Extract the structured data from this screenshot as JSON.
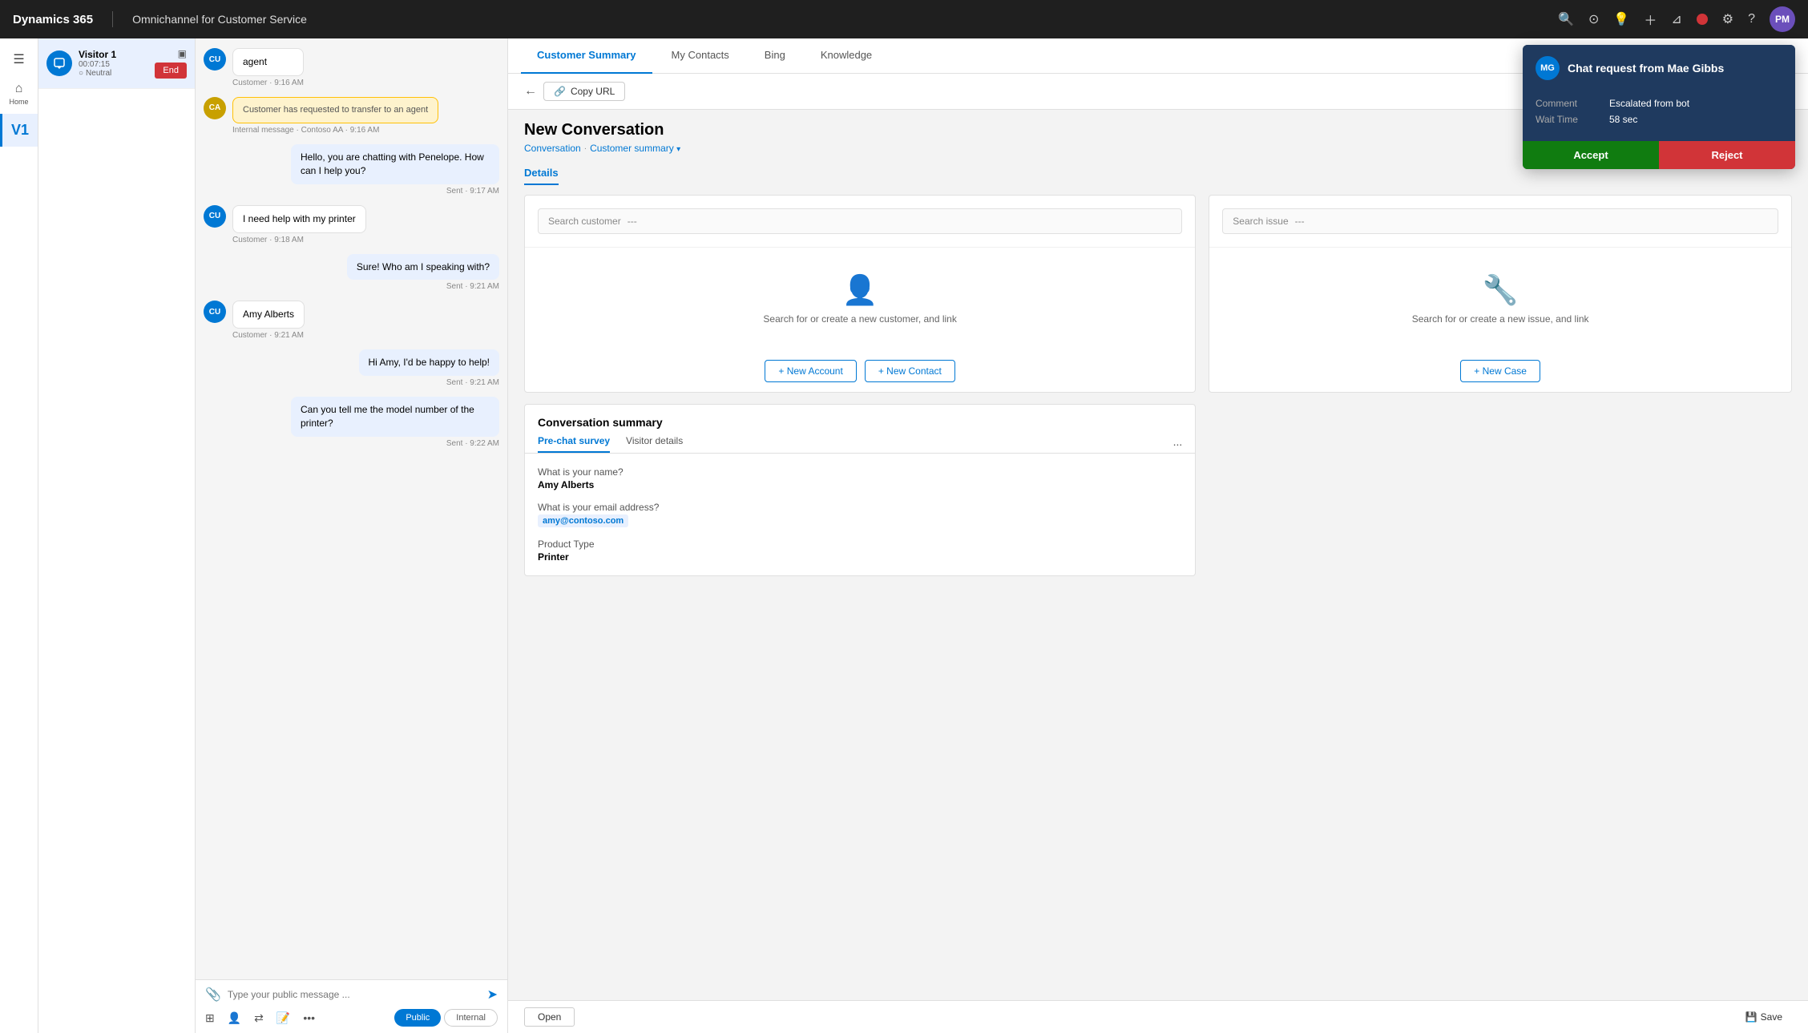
{
  "brand": {
    "name": "Dynamics 365",
    "app": "Omnichannel for Customer Service"
  },
  "topnav": {
    "icons": [
      "search",
      "dashboard",
      "idea",
      "add",
      "filter",
      "settings",
      "help"
    ],
    "avatar_label": "PM"
  },
  "sidebar": {
    "home_label": "Home",
    "visitor_label": "Visitor 1"
  },
  "conversation_panel": {
    "visitor_name": "Visitor 1",
    "timer": "00:07:15",
    "sentiment": "Neutral",
    "end_button": "End"
  },
  "messages": [
    {
      "type": "agent",
      "text": "agent",
      "meta": "Customer · 9:16 AM",
      "avatar": "CU"
    },
    {
      "type": "system",
      "text": "Customer has requested to transfer to an agent",
      "meta": "Internal message · Contoso AA · 9:16 AM",
      "avatar": "CA"
    },
    {
      "type": "sent",
      "text": "Hello, you are chatting with Penelope. How can I help you?",
      "meta": "Sent · 9:17 AM"
    },
    {
      "type": "customer",
      "text": "I need help with my printer",
      "meta": "Customer · 9:18 AM",
      "avatar": "CU"
    },
    {
      "type": "sent",
      "text": "Sure! Who am I speaking with?",
      "meta": "Sent · 9:21 AM"
    },
    {
      "type": "customer",
      "text": "Amy Alberts",
      "meta": "Customer · 9:21 AM",
      "avatar": "CU"
    },
    {
      "type": "sent",
      "text": "Hi Amy, I'd be happy to help!",
      "meta": "Sent · 9:21 AM"
    },
    {
      "type": "sent",
      "text": "Can you tell me the model number of the printer?",
      "meta": "Sent · 9:22 AM"
    }
  ],
  "chat_input": {
    "placeholder": "Type your public message ...",
    "modes": [
      "Public",
      "Internal"
    ]
  },
  "tabs": {
    "items": [
      "Customer Summary",
      "My Contacts",
      "Bing",
      "Knowledge"
    ]
  },
  "page": {
    "title": "New Conversation",
    "breadcrumb_part1": "Conversation",
    "breadcrumb_part2": "Customer summary",
    "details_tab": "Details"
  },
  "customer_section": {
    "search_placeholder": "Search customer",
    "search_dashes": "---",
    "empty_text": "Search for or create a new customer, and link",
    "new_account_btn": "+ New Account",
    "new_contact_btn": "+ New Contact"
  },
  "issue_section": {
    "search_placeholder": "Search issue",
    "search_dashes": "---",
    "empty_text": "Search for or create a new issue, and link",
    "new_case_btn": "+ New Case"
  },
  "conversation_summary": {
    "title": "Conversation summary",
    "tabs": [
      "Pre-chat survey",
      "Visitor details"
    ],
    "more_label": "...",
    "survey": [
      {
        "question": "What is your name?",
        "answer": "Amy Alberts"
      },
      {
        "question": "What is your email address?",
        "answer": "amy@contoso.com",
        "type": "email"
      },
      {
        "question": "Product Type",
        "answer": "Printer"
      }
    ]
  },
  "notification": {
    "title": "Chat request from Mae Gibbs",
    "avatar": "MG",
    "comment_label": "Comment",
    "comment_value": "Escalated from bot",
    "wait_label": "Wait Time",
    "wait_value": "58 sec",
    "accept_btn": "Accept",
    "reject_btn": "Reject"
  },
  "bottom_bar": {
    "open_label": "Open",
    "save_label": "Save"
  },
  "copy_url_btn": "Copy URL"
}
